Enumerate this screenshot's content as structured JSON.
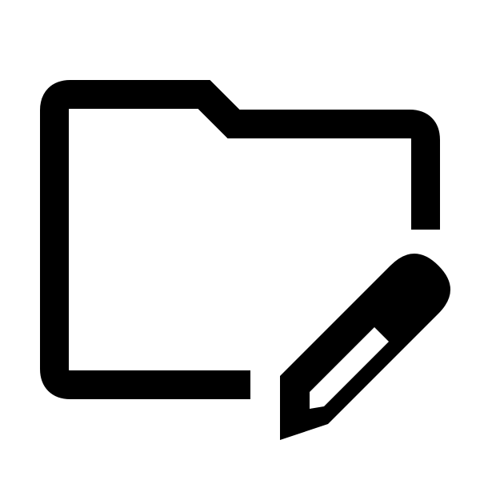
{
  "icon": {
    "name": "folder-edit-icon",
    "parts": [
      "folder-outline",
      "pencil"
    ],
    "color": "#000000",
    "background": "#ffffff"
  }
}
